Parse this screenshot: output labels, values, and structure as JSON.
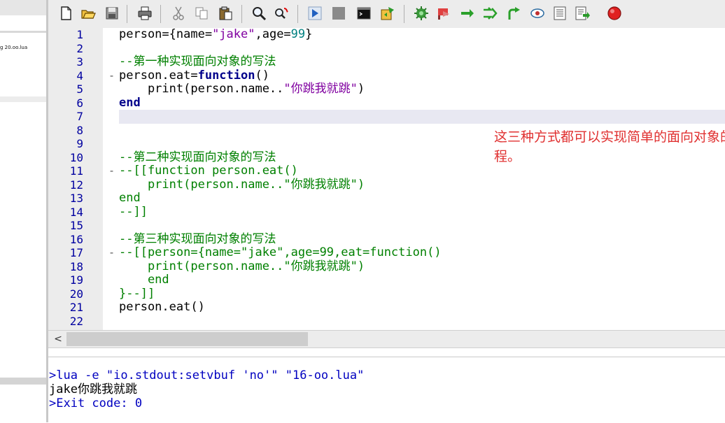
{
  "left_pane": {
    "file_label": "g 20.oo.lua"
  },
  "toolbar": {
    "buttons": [
      "new-icon",
      "open-icon",
      "save-icon",
      "print-icon",
      "cut-icon",
      "copy-icon",
      "paste-icon",
      "find-icon",
      "replace-icon",
      "compile-icon",
      "build-icon",
      "console-icon",
      "run-icon",
      "debug-icon",
      "stop-debug-icon",
      "step-icon",
      "step-over-icon",
      "step-out-icon",
      "watch-icon",
      "stack-icon",
      "output-icon",
      "breakpoint-icon"
    ]
  },
  "editor": {
    "line_numbers": [
      "1",
      "2",
      "3",
      "4",
      "5",
      "6",
      "7",
      "8",
      "9",
      "10",
      "11",
      "12",
      "13",
      "14",
      "15",
      "16",
      "17",
      "18",
      "19",
      "20",
      "21",
      "22"
    ],
    "lines": {
      "l1_a": "person={name=",
      "l1_b": "\"jake\"",
      "l1_c": ",age=",
      "l1_d": "99",
      "l1_e": "}",
      "l3": "--第一种实现面向对象的写法",
      "l4_a": "person.eat=",
      "l4_b": "function",
      "l4_c": "()",
      "l5_a": "    print(person.name..",
      "l5_b": "\"你跳我就跳\"",
      "l5_c": ")",
      "l6": "end",
      "l10": "--第二种实现面向对象的写法",
      "l11": "--[[function person.eat()",
      "l12": "    print(person.name..\"你跳我就跳\")",
      "l13": "end",
      "l14": "--]]",
      "l16": "--第三种实现面向对象的写法",
      "l17": "--[[person={name=\"jake\",age=99,eat=function()",
      "l18": "    print(person.name..\"你跳我就跳\")",
      "l19": "    end",
      "l20": "}--]]",
      "l21": "person.eat()"
    },
    "fold_markers": {
      "l4": "-",
      "l11": "-",
      "l17": "-"
    },
    "annotation": "这三种方式都可以实现简单的面向对象的编程。"
  },
  "scrollbar": {
    "left_arrow": "<"
  },
  "output": {
    "lines": [
      ">lua -e \"io.stdout:setvbuf 'no'\" \"16-oo.lua\"",
      "jake你跳我就跳",
      ">Exit code: 0"
    ]
  }
}
